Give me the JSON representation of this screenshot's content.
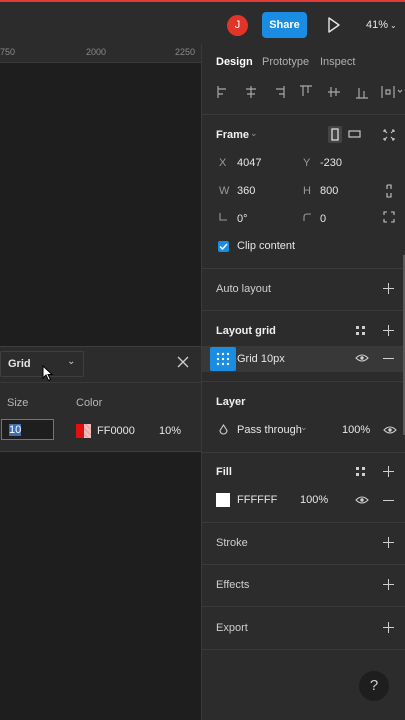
{
  "topbar": {
    "avatar_initial": "J",
    "share_label": "Share",
    "zoom_label": "41%",
    "accent": "#1a8ce2",
    "avatar_color": "#e2352a"
  },
  "ruler": {
    "ticks": [
      "750",
      "2000",
      "2250"
    ]
  },
  "grid_popup": {
    "type_label": "Grid",
    "size_header": "Size",
    "color_header": "Color",
    "size_value": "10",
    "color_hex": "FF0000",
    "opacity": "10%"
  },
  "panel": {
    "tabs": [
      "Design",
      "Prototype",
      "Inspect"
    ],
    "frame": {
      "title": "Frame",
      "x_label": "X",
      "x_value": "4047",
      "y_label": "Y",
      "y_value": "-230",
      "w_label": "W",
      "w_value": "360",
      "h_label": "H",
      "h_value": "800",
      "rotation": "0°",
      "radius": "0",
      "clip_label": "Clip content"
    },
    "auto_layout_title": "Auto layout",
    "layout_grid": {
      "title": "Layout grid",
      "item_label": "Grid 10px"
    },
    "layer": {
      "title": "Layer",
      "blend": "Pass through",
      "opacity": "100%"
    },
    "fill": {
      "title": "Fill",
      "hex": "FFFFFF",
      "opacity": "100%"
    },
    "stroke_title": "Stroke",
    "effects_title": "Effects",
    "export_title": "Export",
    "help_label": "?"
  }
}
